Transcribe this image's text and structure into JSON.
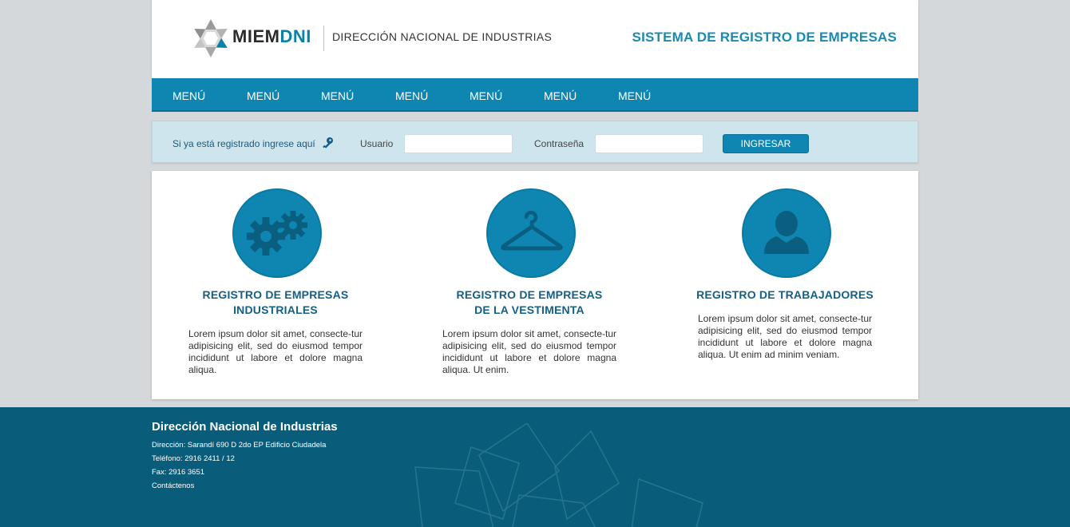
{
  "header": {
    "brand_main": "MIEM",
    "brand_accent": "DNI",
    "brand_subtitle": "DIRECCIÓN NACIONAL DE INDUSTRIAS",
    "system_title": "SISTEMA DE REGISTRO DE EMPRESAS",
    "logo_icon": "flower-logo-icon"
  },
  "nav": {
    "items": [
      {
        "label": "MENÚ"
      },
      {
        "label": "MENÚ"
      },
      {
        "label": "MENÚ"
      },
      {
        "label": "MENÚ"
      },
      {
        "label": "MENÚ"
      },
      {
        "label": "MENÚ"
      },
      {
        "label": "MENÚ"
      }
    ]
  },
  "login": {
    "prompt": "Si ya está registrado ingrese aquí",
    "prompt_icon": "key-icon",
    "user_label": "Usuario",
    "user_value": "",
    "password_label": "Contraseña",
    "password_value": "",
    "submit_label": "INGRESAR"
  },
  "features": [
    {
      "icon": "gears-icon",
      "title_line1": "REGISTRO DE EMPRESAS",
      "title_line2": "INDUSTRIALES",
      "text": "Lorem ipsum dolor sit amet, consecte-tur adipisicing elit, sed do eiusmod tempor incididunt ut labore et dolore magna aliqua."
    },
    {
      "icon": "hanger-icon",
      "title_line1": "REGISTRO DE EMPRESAS",
      "title_line2": "DE LA VESTIMENTA",
      "text": "Lorem ipsum dolor sit amet, consecte-tur adipisicing elit, sed do eiusmod tempor incididunt ut labore et dolore magna aliqua. Ut enim."
    },
    {
      "icon": "user-icon",
      "title_line1": "REGISTRO DE TRABAJADORES",
      "title_line2": "",
      "text": "Lorem ipsum dolor sit amet, consecte-tur adipisicing elit, sed do eiusmod tempor incididunt ut labore et dolore magna aliqua. Ut enim ad minim veniam."
    }
  ],
  "footer": {
    "heading": "Dirección Nacional de Industrias",
    "address": "Dirección: Sarandí 690 D 2do EP Edificio Ciudadela",
    "phone": "Teléfono: 2916 2411 / 12",
    "fax": "Fax: 2916 3651",
    "contact": "Contáctenos"
  },
  "colors": {
    "primary": "#0e86b1",
    "title_blue": "#1a8ab3",
    "footer_bg": "#0a5d7a",
    "login_bg": "#cfe5ee",
    "page_bg": "#d5d8da"
  }
}
